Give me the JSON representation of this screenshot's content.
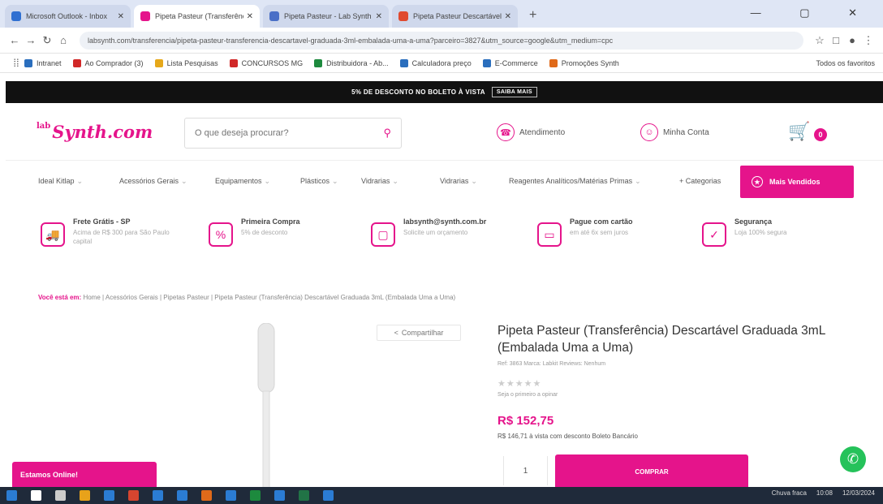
{
  "browser": {
    "tabs": [
      {
        "title": "Microsoft Outlook - Inbox",
        "color": "#2f6fd1",
        "active": false
      },
      {
        "title": "Pipeta Pasteur (Transferência)",
        "color": "#e5148b",
        "active": true
      },
      {
        "title": "Pipeta Pasteur - Lab Synth",
        "color": "#4a6fc7",
        "active": false
      },
      {
        "title": "Pipeta Pasteur Descartável",
        "color": "#e04a2f",
        "active": false
      }
    ],
    "new_tab_label": "+",
    "window_controls": "— ▢ ✕",
    "url": "labsynth.com/transferencia/pipeta-pasteur-transferencia-descartavel-graduada-3ml-embalada-uma-a-uma?parceiro=3827&utm_source=google&utm_medium=cpc",
    "bookmarks": [
      {
        "label": "Intranet",
        "color": "#2a6ebd"
      },
      {
        "label": "Ao Comprador (3)",
        "color": "#d12828"
      },
      {
        "label": "Lista Pesquisas",
        "color": "#e6a81a"
      },
      {
        "label": "CONCURSOS MG",
        "color": "#d12828"
      },
      {
        "label": "Distribuidora - Ab...",
        "color": "#1d8a3e"
      },
      {
        "label": "Calculadora preço",
        "color": "#2a6ebd"
      },
      {
        "label": "E-Commerce",
        "color": "#2a6ebd"
      },
      {
        "label": "Promoções Synth",
        "color": "#e06a1a"
      }
    ],
    "bookmarks_more": "Todos os favoritos"
  },
  "promo": {
    "text": "5% DE DESCONTO NO BOLETO À VISTA",
    "link": "SAIBA MAIS"
  },
  "header": {
    "logo_prefix": "lab",
    "logo": "Synth.com",
    "search_placeholder": "O que deseja procurar?",
    "support_label": "Atendimento",
    "account_label": "Minha Conta",
    "cart_count": "0"
  },
  "menu": {
    "items": [
      "Ideal Kitlap",
      "Acessórios Gerais",
      "Equipamentos",
      "Plásticos",
      "Vidrarias",
      "Vidrarias",
      "Reagentes Analíticos/Matérias Primas",
      "+ Categorias"
    ],
    "best_sellers": "Mais Vendidos"
  },
  "features": [
    {
      "title": "Frete Grátis - SP",
      "desc": "Acima de R$ 300 para São Paulo capital",
      "icon": "🚚"
    },
    {
      "title": "Primeira Compra",
      "desc": "5% de desconto",
      "icon": "%"
    },
    {
      "title": "labsynth@synth.com.br",
      "desc": "Solicite um orçamento",
      "icon": "▢"
    },
    {
      "title": "Pague com cartão",
      "desc": "em até 6x sem juros",
      "icon": "▭"
    },
    {
      "title": "Segurança",
      "desc": "Loja 100% segura",
      "icon": "✓"
    }
  ],
  "breadcrumb": {
    "here": "Você está em:",
    "path": "Home  |  Acessórios Gerais  |  Pipetas Pasteur  |  Pipeta Pasteur (Transferência) Descartável Graduada 3mL (Embalada Uma a Uma)"
  },
  "product": {
    "share_label": "Compartilhar",
    "title": "Pipeta Pasteur (Transferência) Descartável Graduada 3mL (Embalada Uma a Uma)",
    "sku": "Ref: 3863    Marca: Labkit    Reviews: Nenhum",
    "stars": "★★★★★",
    "review_link": "Seja o primeiro a opinar",
    "price": "R$ 152,75",
    "pix_text": "R$ 146,71 à vista com desconto Boleto Bancário",
    "qty": "1",
    "buy_label": "COMPRAR",
    "whatsapp_icon": "✆"
  },
  "floating_tab": "Estamos Online!",
  "taskbar": {
    "icons": [
      "#2b7cd3",
      "#ffffff",
      "#cccccc",
      "#e8a21a",
      "#2b7cd3",
      "#d6452f",
      "#2b7cd3",
      "#2b7cd3",
      "#e06a1a",
      "#2b7cd3",
      "#1d8a3e",
      "#2b7cd3",
      "#217346",
      "#2b7cd3"
    ],
    "weather": "Chuva fraca",
    "time": "10:08",
    "date": "12/03/2024"
  }
}
